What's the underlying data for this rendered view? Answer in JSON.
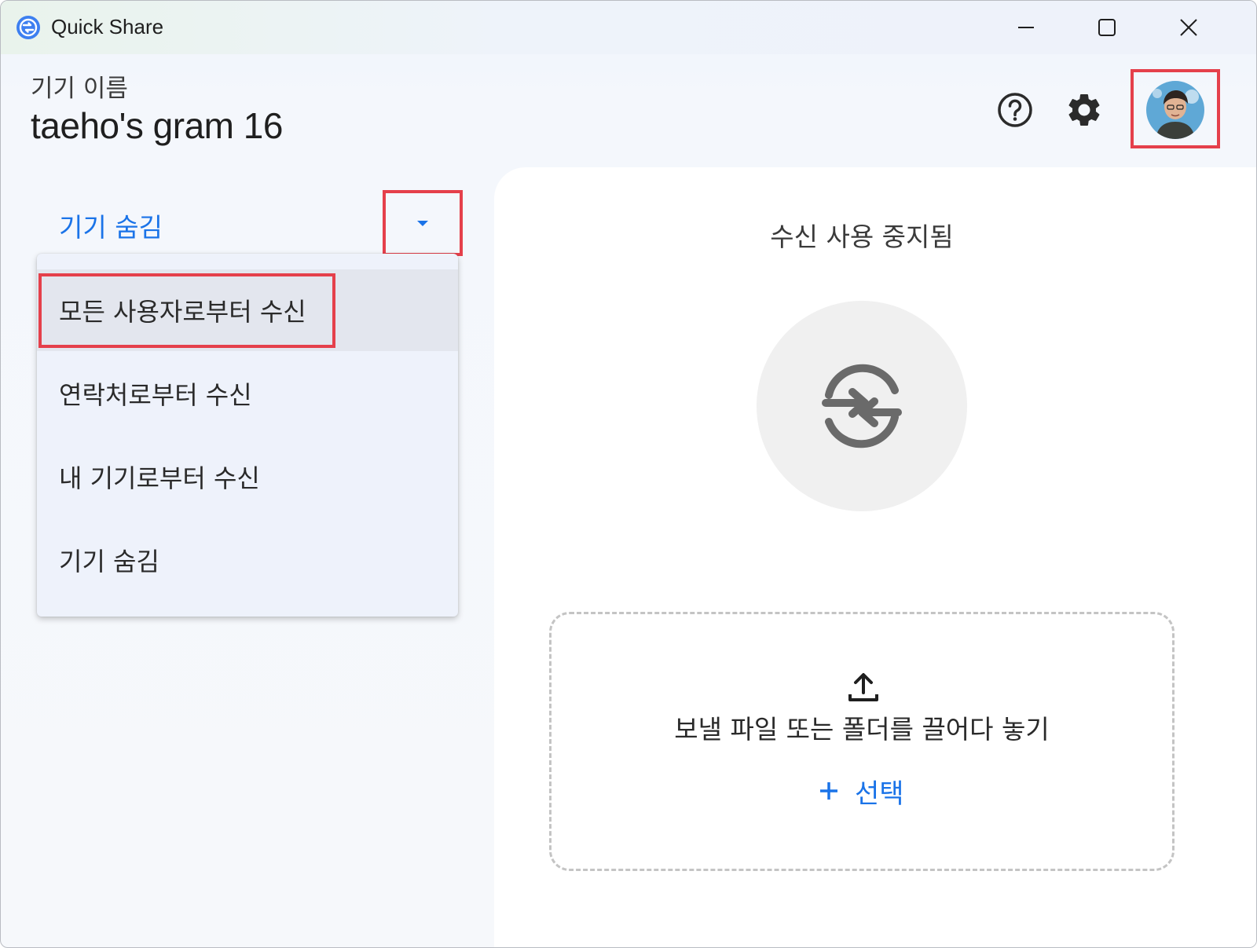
{
  "window": {
    "title": "Quick Share",
    "icon": "quick-share-icon",
    "controls": {
      "minimize": "minimize-icon",
      "maximize": "maximize-icon",
      "close": "close-icon"
    }
  },
  "header": {
    "device_caption": "기기 이름",
    "device_name": "taeho's gram 16",
    "help_icon": "help-icon",
    "settings_icon": "gear-icon",
    "avatar": "user-avatar"
  },
  "visibility": {
    "current_label": "기기 숨김",
    "dropdown_icon": "caret-down-icon",
    "options": [
      {
        "label": "모든 사용자로부터 수신",
        "highlighted": true
      },
      {
        "label": "연락처로부터 수신",
        "highlighted": false
      },
      {
        "label": "내 기기로부터 수신",
        "highlighted": false
      },
      {
        "label": "기기 숨김",
        "highlighted": false
      }
    ]
  },
  "receive_panel": {
    "status": "수신 사용 중지됨",
    "icon": "sync-arrows-icon"
  },
  "send_panel": {
    "upload_icon": "upload-icon",
    "drop_text": "보낼 파일 또는 폴더를 끌어다 놓기",
    "select_label": "선택",
    "select_icon": "plus-icon"
  },
  "colors": {
    "accent": "#1a73e8",
    "highlight_box": "#e5404b",
    "menu_bg": "#eef2fb",
    "menu_selected_bg": "#e3e6ee"
  }
}
